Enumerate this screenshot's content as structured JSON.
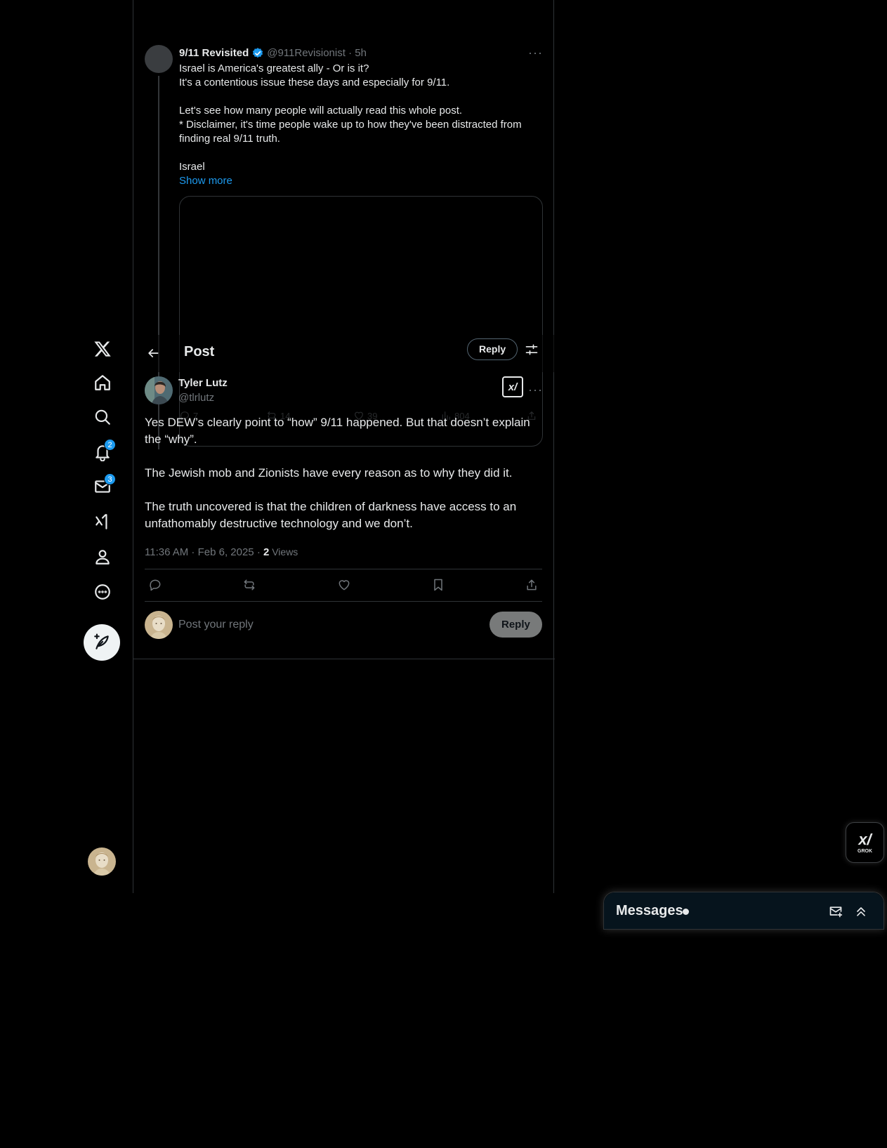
{
  "nav": {
    "badges": {
      "notifications": "2",
      "messages": "3"
    }
  },
  "header": {
    "title": "Post",
    "reply_label": "Reply"
  },
  "parent_post": {
    "name": "9/11 Revisited",
    "meta": "@911Revisionist · 5h",
    "text": "Israel is America's greatest ally - Or is it?\nIt's a contentious issue these days and especially for 9/11.\n\nLet's see how many people will actually read this whole post.\n* Disclaimer, it's time people wake up to how they've been distracted from finding real 9/11 truth.\n\nIsrael",
    "show_more": "Show more",
    "stats": {
      "replies": "7",
      "reposts": "14",
      "likes": "39",
      "views": "804"
    }
  },
  "focused_post": {
    "name": "Tyler Lutz",
    "handle": "@tlrlutz",
    "text": "Yes DEW’s clearly point to “how” 9/11 happened. But that doesn’t explain the “why”.\n\nThe Jewish mob and Zionists have every reason as to why they did it.\n\nThe truth uncovered is that the children of darkness have access to an unfathomably destructive technology and we don’t.",
    "timestamp": "11:36 AM · Feb 6, 2025 · ",
    "views_count": "2",
    "views_label": " Views"
  },
  "reply_box": {
    "placeholder": "Post your reply",
    "button": "Reply"
  },
  "grok": {
    "label": "GROK"
  },
  "messages": {
    "title": "Messages"
  },
  "colors": {
    "accent": "#1d9bf0",
    "background": "#000000",
    "text": "#e7e9ea",
    "muted": "#71767b"
  }
}
